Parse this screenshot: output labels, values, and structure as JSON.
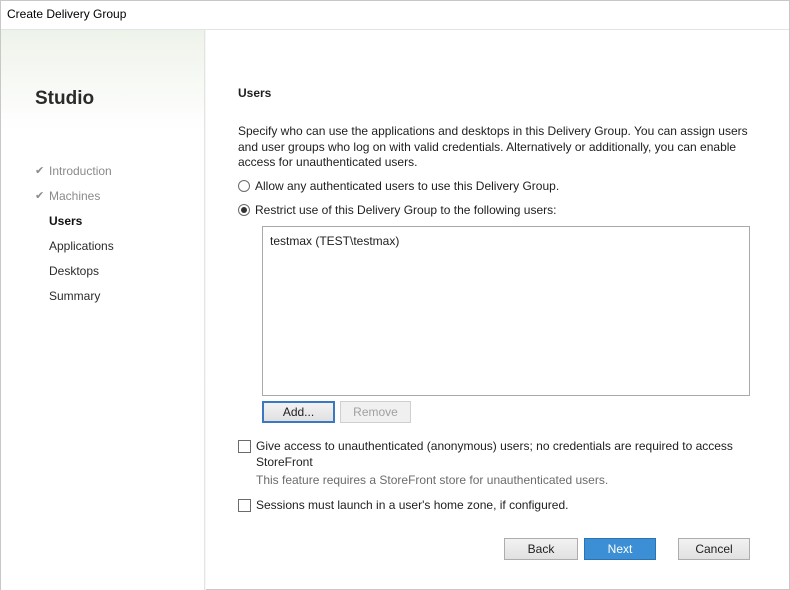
{
  "window": {
    "title": "Create Delivery Group"
  },
  "sidebar": {
    "brand": "Studio",
    "items": [
      {
        "label": "Introduction",
        "state": "done",
        "icon": "check-icon"
      },
      {
        "label": "Machines",
        "state": "done",
        "icon": "check-icon"
      },
      {
        "label": "Users",
        "state": "current"
      },
      {
        "label": "Applications",
        "state": "pending"
      },
      {
        "label": "Desktops",
        "state": "pending"
      },
      {
        "label": "Summary",
        "state": "pending"
      }
    ]
  },
  "page": {
    "heading": "Users",
    "description": "Specify who can use the applications and desktops in this Delivery Group. You can assign users and user groups who log on with valid credentials. Alternatively or additionally, you can enable access for unauthenticated users.",
    "radio_any": {
      "label": "Allow any authenticated users to use this Delivery Group.",
      "checked": false
    },
    "radio_restrict": {
      "label": "Restrict use of this Delivery Group to the following users:",
      "checked": true
    },
    "users": [
      "testmax (TEST\\testmax)"
    ],
    "add_label": "Add...",
    "remove_label": "Remove",
    "unauth_checkbox": {
      "label": "Give access to unauthenticated (anonymous) users; no credentials are required to access StoreFront",
      "checked": false
    },
    "unauth_note": "This feature requires a StoreFront store for unauthenticated users.",
    "homezone_checkbox": {
      "label": "Sessions must launch in a user's home zone, if configured.",
      "checked": false
    }
  },
  "footer": {
    "back_label": "Back",
    "next_label": "Next",
    "cancel_label": "Cancel"
  },
  "colors": {
    "primary_button": "#3c8fd4",
    "sidebar_tint": "#eef3ea"
  }
}
